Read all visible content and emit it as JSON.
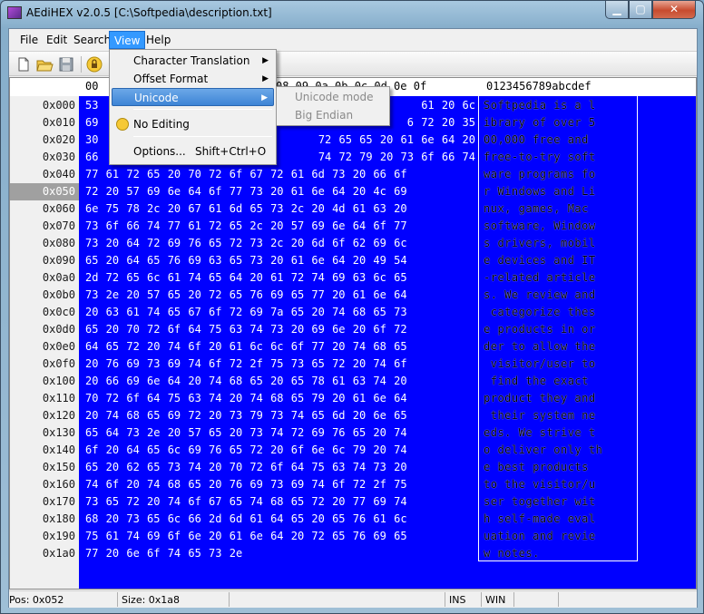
{
  "window": {
    "title": "AEdiHEX v2.0.5 [C:\\Softpedia\\description.txt]",
    "minimize_glyph": "▁",
    "maximize_glyph": "▢",
    "close_glyph": "✕"
  },
  "menubar": [
    {
      "label": "File"
    },
    {
      "label": "Edit"
    },
    {
      "label": "Search"
    },
    {
      "label": "View"
    },
    {
      "label": "Help"
    }
  ],
  "toolbar": {
    "icons": [
      "new-file-icon",
      "open-folder-icon",
      "save-disk-icon",
      "lock-icon"
    ]
  },
  "view_menu": {
    "items": [
      {
        "label": "Character Translation",
        "has_submenu": true
      },
      {
        "label": "Offset Format",
        "has_submenu": true
      },
      {
        "label": "Unicode",
        "has_submenu": true,
        "highlighted": true
      },
      {
        "label": "No Editing",
        "icon": "lock-icon"
      },
      {
        "label": "Options...",
        "shortcut": "Shift+Ctrl+O"
      }
    ],
    "arrow_glyph": "▶"
  },
  "unicode_submenu": {
    "items": [
      {
        "label": "Unicode mode",
        "enabled": false
      },
      {
        "label": "Big Endian",
        "enabled": false
      }
    ]
  },
  "editor": {
    "header_offset": "00",
    "header_hex": "08 09 0a 0b 0c 0d 0e 0f",
    "header_ascii": "0123456789abcdef",
    "current_row": "0x050",
    "rows": [
      {
        "addr": "0x000",
        "hex": "53",
        "hex_right": "61 20 6c",
        "ascii": "Softpedia is a l"
      },
      {
        "addr": "0x010",
        "hex": "69",
        "hex_right": "6 72 20 35",
        "ascii": "ibrary of over 5"
      },
      {
        "addr": "0x020",
        "hex": "30",
        "hex_right": "72 65 65 20 61 6e 64 20",
        "ascii": "00,000 free and "
      },
      {
        "addr": "0x030",
        "hex": "66",
        "hex_right": "74 72 79 20 73 6f 66 74",
        "ascii": "free-to-try soft"
      },
      {
        "addr": "0x040",
        "hex": "77 61 72 65 20 70 72 6f 67 72 61 6d 73 20 66 6f",
        "ascii": "ware programs fo"
      },
      {
        "addr": "0x050",
        "hex": "72 20 57 69 6e 64 6f 77 73 20 61 6e 64 20 4c 69",
        "ascii": "r Windows and Li"
      },
      {
        "addr": "0x060",
        "hex": "6e 75 78 2c 20 67 61 6d 65 73 2c 20 4d 61 63 20",
        "ascii": "nux, games, Mac "
      },
      {
        "addr": "0x070",
        "hex": "73 6f 66 74 77 61 72 65 2c 20 57 69 6e 64 6f 77",
        "ascii": "software, Window"
      },
      {
        "addr": "0x080",
        "hex": "73 20 64 72 69 76 65 72 73 2c 20 6d 6f 62 69 6c",
        "ascii": "s drivers, mobil"
      },
      {
        "addr": "0x090",
        "hex": "65 20 64 65 76 69 63 65 73 20 61 6e 64 20 49 54",
        "ascii": "e devices and IT"
      },
      {
        "addr": "0x0a0",
        "hex": "2d 72 65 6c 61 74 65 64 20 61 72 74 69 63 6c 65",
        "ascii": "-related article"
      },
      {
        "addr": "0x0b0",
        "hex": "73 2e 20 57 65 20 72 65 76 69 65 77 20 61 6e 64",
        "ascii": "s. We review and"
      },
      {
        "addr": "0x0c0",
        "hex": "20 63 61 74 65 67 6f 72 69 7a 65 20 74 68 65 73",
        "ascii": " categorize thes"
      },
      {
        "addr": "0x0d0",
        "hex": "65 20 70 72 6f 64 75 63 74 73 20 69 6e 20 6f 72",
        "ascii": "e products in or"
      },
      {
        "addr": "0x0e0",
        "hex": "64 65 72 20 74 6f 20 61 6c 6c 6f 77 20 74 68 65",
        "ascii": "der to allow the"
      },
      {
        "addr": "0x0f0",
        "hex": "20 76 69 73 69 74 6f 72 2f 75 73 65 72 20 74 6f",
        "ascii": " visitor/user to"
      },
      {
        "addr": "0x100",
        "hex": "20 66 69 6e 64 20 74 68 65 20 65 78 61 63 74 20",
        "ascii": " find the exact "
      },
      {
        "addr": "0x110",
        "hex": "70 72 6f 64 75 63 74 20 74 68 65 79 20 61 6e 64",
        "ascii": "product they and"
      },
      {
        "addr": "0x120",
        "hex": "20 74 68 65 69 72 20 73 79 73 74 65 6d 20 6e 65",
        "ascii": " their system ne"
      },
      {
        "addr": "0x130",
        "hex": "65 64 73 2e 20 57 65 20 73 74 72 69 76 65 20 74",
        "ascii": "eds. We strive t"
      },
      {
        "addr": "0x140",
        "hex": "6f 20 64 65 6c 69 76 65 72 20 6f 6e 6c 79 20 74",
        "ascii": "o deliver only th"
      },
      {
        "addr": "0x150",
        "hex": "65 20 62 65 73 74 20 70 72 6f 64 75 63 74 73 20",
        "ascii": "e best products "
      },
      {
        "addr": "0x160",
        "hex": "74 6f 20 74 68 65 20 76 69 73 69 74 6f 72 2f 75",
        "ascii": "to the visitor/u"
      },
      {
        "addr": "0x170",
        "hex": "73 65 72 20 74 6f 67 65 74 68 65 72 20 77 69 74",
        "ascii": "ser together wit"
      },
      {
        "addr": "0x180",
        "hex": "68 20 73 65 6c 66 2d 6d 61 64 65 20 65 76 61 6c",
        "ascii": "h self-made eval"
      },
      {
        "addr": "0x190",
        "hex": "75 61 74 69 6f 6e 20 61 6e 64 20 72 65 76 69 65",
        "ascii": "uation and revie"
      },
      {
        "addr": "0x1a0",
        "hex": "77 20 6e 6f 74 65 73 2e",
        "ascii": "w notes."
      }
    ]
  },
  "statusbar": {
    "position": "Pos: 0x052",
    "size": "Size: 0x1a8",
    "ins": "INS",
    "win": "WIN"
  }
}
